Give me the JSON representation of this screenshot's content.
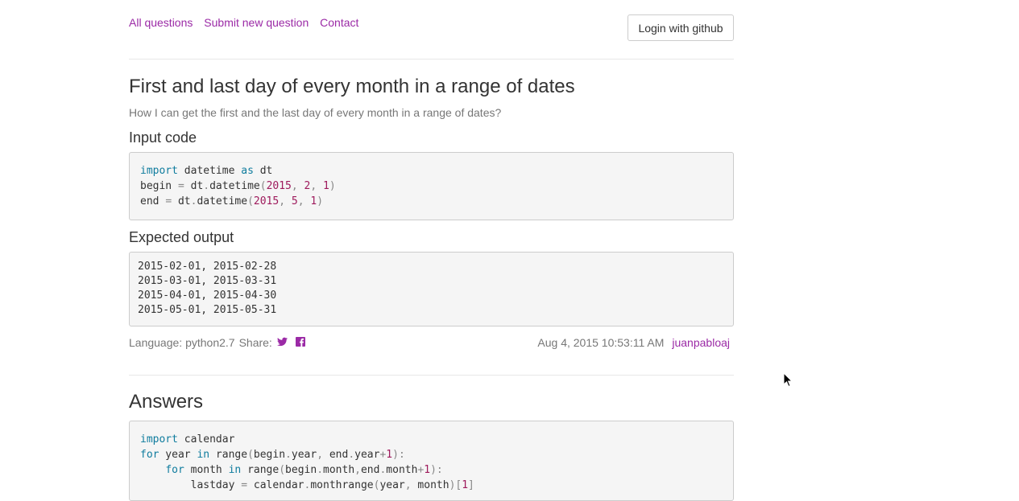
{
  "nav": {
    "items": [
      "All questions",
      "Submit new question",
      "Contact"
    ],
    "login_label": "Login with github"
  },
  "question": {
    "title": "First and last day of every month in a range of dates",
    "description": "How I can get the first and the last day of every month in a range of dates?",
    "input_heading": "Input code",
    "input_code": [
      "import datetime as dt",
      "begin = dt.datetime(2015, 2, 1)",
      "end = dt.datetime(2015, 5, 1)"
    ],
    "output_heading": "Expected output",
    "output_lines": [
      "2015-02-01, 2015-02-28",
      "2015-03-01, 2015-03-31",
      "2015-04-01, 2015-04-30",
      "2015-05-01, 2015-05-31"
    ],
    "language_label": "Language: python2.7",
    "share_label": "Share:",
    "timestamp": "Aug 4, 2015 10:53:11 AM",
    "author": "juanpabloaj"
  },
  "answers": {
    "heading": "Answers",
    "code": [
      "import calendar",
      "for year in range(begin.year, end.year+1):",
      "    for month in range(begin.month,end.month+1):",
      "        lastday = calendar.monthrange(year, month)[1]"
    ]
  },
  "colors": {
    "link": "#9b2aa6",
    "keyword": "#0f7c9e",
    "number": "#9e1a5c"
  }
}
